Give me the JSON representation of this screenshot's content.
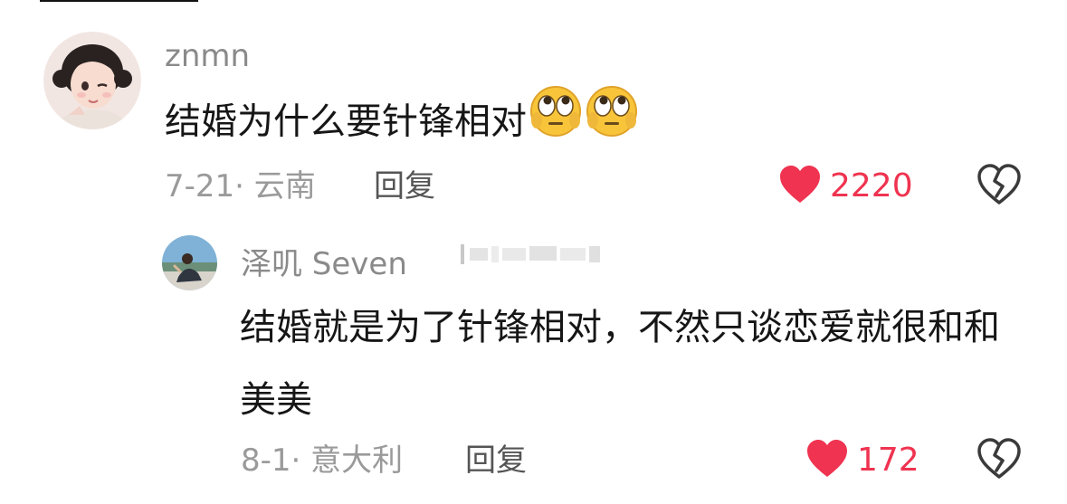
{
  "comments": [
    {
      "username": "znmn",
      "text": "结婚为什么要针锋相对",
      "emoji": "face-with-rolling-eyes-icon",
      "meta": "7-21· 云南",
      "reply_label": "回复",
      "likes": "2220"
    },
    {
      "username": "泽叽 Seven",
      "text": "结婚就是为了针锋相对，不然只谈恋爱就很和和美美",
      "meta": "8-1· 意大利",
      "reply_label": "回复",
      "likes": "172"
    }
  ],
  "colors": {
    "like_red": "#ef3350",
    "name_gray": "#8a8a8a",
    "meta_gray": "#9a9a9a",
    "text_dark": "#161616"
  }
}
